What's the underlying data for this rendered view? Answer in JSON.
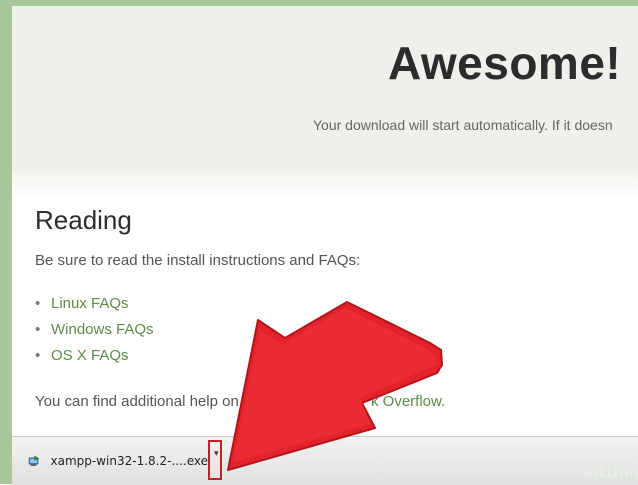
{
  "hero": {
    "title": "Awesome!",
    "subtitle": "Your download will start automatically. If it doesn"
  },
  "reading": {
    "title": "Reading",
    "intro": "Be sure to read the install instructions and FAQs:",
    "bullet": "•",
    "faqs": [
      {
        "label": "Linux FAQs"
      },
      {
        "label": "Windows FAQs"
      },
      {
        "label": "OS X FAQs"
      }
    ],
    "help_prefix": "You can find additional help on ou",
    "help_suffix": "k Overflow."
  },
  "download_bar": {
    "filename": "xampp-win32-1.8.2-....exe",
    "menu_glyph": "▾"
  },
  "watermark": {
    "text": "wiki",
    "text2": "How"
  },
  "colors": {
    "link": "#5d8a46",
    "arrow": "#e3232b",
    "highlight": "#c81d25",
    "border": "#a9c59a"
  },
  "icons": {
    "installer": "installer-icon",
    "arrow": "pointer-arrow-overlay"
  }
}
